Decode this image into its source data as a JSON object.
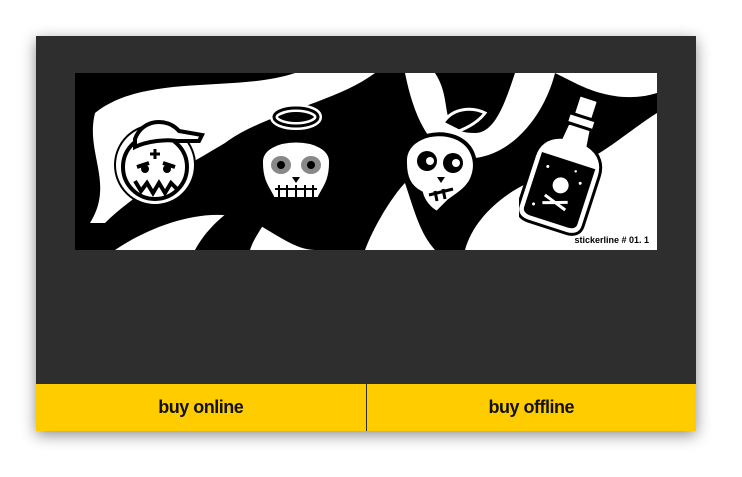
{
  "banner": {
    "caption": "stickerline # 01. 1",
    "stickers": [
      "cap-kid-face-icon",
      "halo-skull-icon",
      "winged-skull-icon",
      "poison-bottle-icon"
    ]
  },
  "actions": {
    "buy_online_label": "buy online",
    "buy_offline_label": "buy offline"
  },
  "colors": {
    "card_bg": "#2e2e2e",
    "accent": "#ffcc00",
    "banner_bg": "#000000",
    "banner_shape": "#ffffff"
  }
}
